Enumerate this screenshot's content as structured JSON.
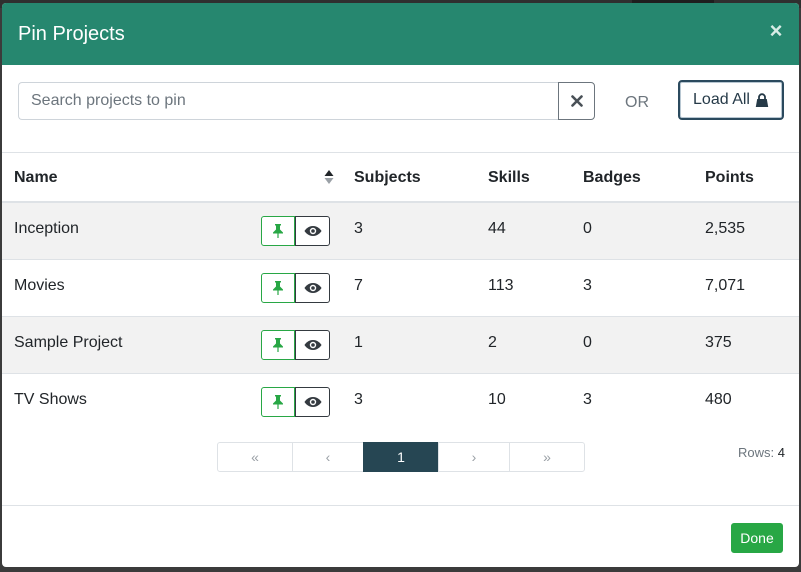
{
  "modal": {
    "title": "Pin Projects",
    "close_symbol": "×"
  },
  "search": {
    "placeholder": "Search projects to pin",
    "value": "",
    "or_label": "OR",
    "load_all_label": "Load All"
  },
  "table": {
    "columns": {
      "name": "Name",
      "subjects": "Subjects",
      "skills": "Skills",
      "badges": "Badges",
      "points": "Points"
    },
    "rows": [
      {
        "name": "Inception",
        "subjects": "3",
        "skills": "44",
        "badges": "0",
        "points": "2,535"
      },
      {
        "name": "Movies",
        "subjects": "7",
        "skills": "113",
        "badges": "3",
        "points": "7,071"
      },
      {
        "name": "Sample Project",
        "subjects": "1",
        "skills": "2",
        "badges": "0",
        "points": "375"
      },
      {
        "name": "TV Shows",
        "subjects": "3",
        "skills": "10",
        "badges": "3",
        "points": "480"
      }
    ]
  },
  "pagination": {
    "first": "«",
    "prev": "‹",
    "current": "1",
    "next": "›",
    "last": "»",
    "rows_label": "Rows:",
    "rows_count": "4"
  },
  "footer": {
    "done_label": "Done"
  },
  "colors": {
    "header_bg": "#26876f",
    "pin_green": "#28a745",
    "active_page": "#264653",
    "load_all_border": "#2b4a5e"
  },
  "icons": {
    "sort": "sort-icon",
    "pin": "pin-icon",
    "view": "eye-icon",
    "clear": "times-icon",
    "lock": "lock-icon"
  }
}
